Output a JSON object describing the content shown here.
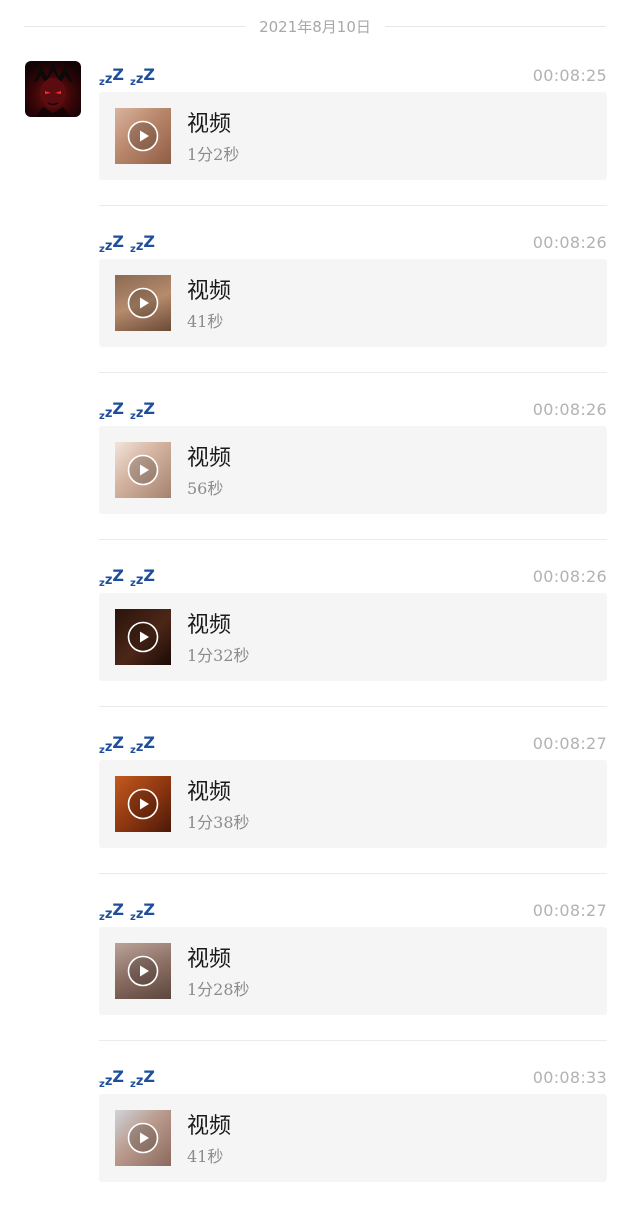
{
  "date_divider": "2021年8月10日",
  "messages": [
    {
      "time": "00:08:25",
      "title": "视频",
      "duration": "1分2秒"
    },
    {
      "time": "00:08:26",
      "title": "视频",
      "duration": "41秒"
    },
    {
      "time": "00:08:26",
      "title": "视频",
      "duration": "56秒"
    },
    {
      "time": "00:08:26",
      "title": "视频",
      "duration": "1分32秒"
    },
    {
      "time": "00:08:27",
      "title": "视频",
      "duration": "1分38秒"
    },
    {
      "time": "00:08:27",
      "title": "视频",
      "duration": "1分28秒"
    },
    {
      "time": "00:08:33",
      "title": "视频",
      "duration": "41秒"
    }
  ],
  "icons": {
    "sender_name": "zzz-icon zzz-icon",
    "video": "play-icon",
    "avatar": "avatar-image"
  },
  "colors": {
    "zzz": "#1f4f9c",
    "time": "#b2b2b2",
    "card_bg": "#f5f5f5",
    "duration": "#8c8c8c"
  }
}
